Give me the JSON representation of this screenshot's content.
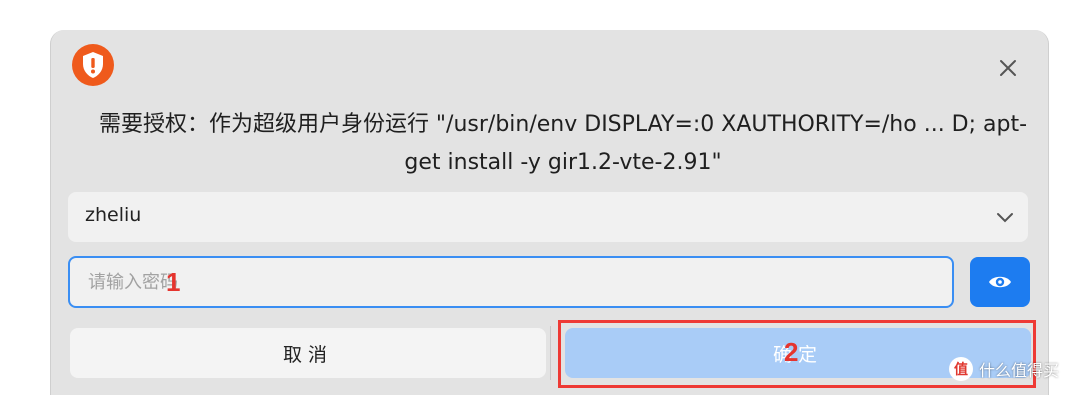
{
  "dialog": {
    "prompt": "需要授权：作为超级用户身份运行 \"/usr/bin/env DISPLAY=:0 XAUTHORITY=/ho ... D; apt-get install -y gir1.2-vte-2.91\"",
    "user_select": {
      "value": "zheliu"
    },
    "password": {
      "placeholder": "请输入密码",
      "value": ""
    },
    "buttons": {
      "cancel": "取消",
      "confirm": "确定"
    }
  },
  "icons": {
    "shield": "shield-alert-icon",
    "close": "close-icon",
    "chevron": "chevron-down-icon",
    "eye": "eye-icon"
  },
  "annotations": {
    "marker1": "1",
    "marker2": "2"
  },
  "watermark": {
    "badge": "值",
    "text": "什么值得买"
  },
  "colors": {
    "accent": "#1d7cf0",
    "shield": "#ef5a1c",
    "annotation": "#ee3a35",
    "confirm_disabled": "#a9ccf7"
  }
}
